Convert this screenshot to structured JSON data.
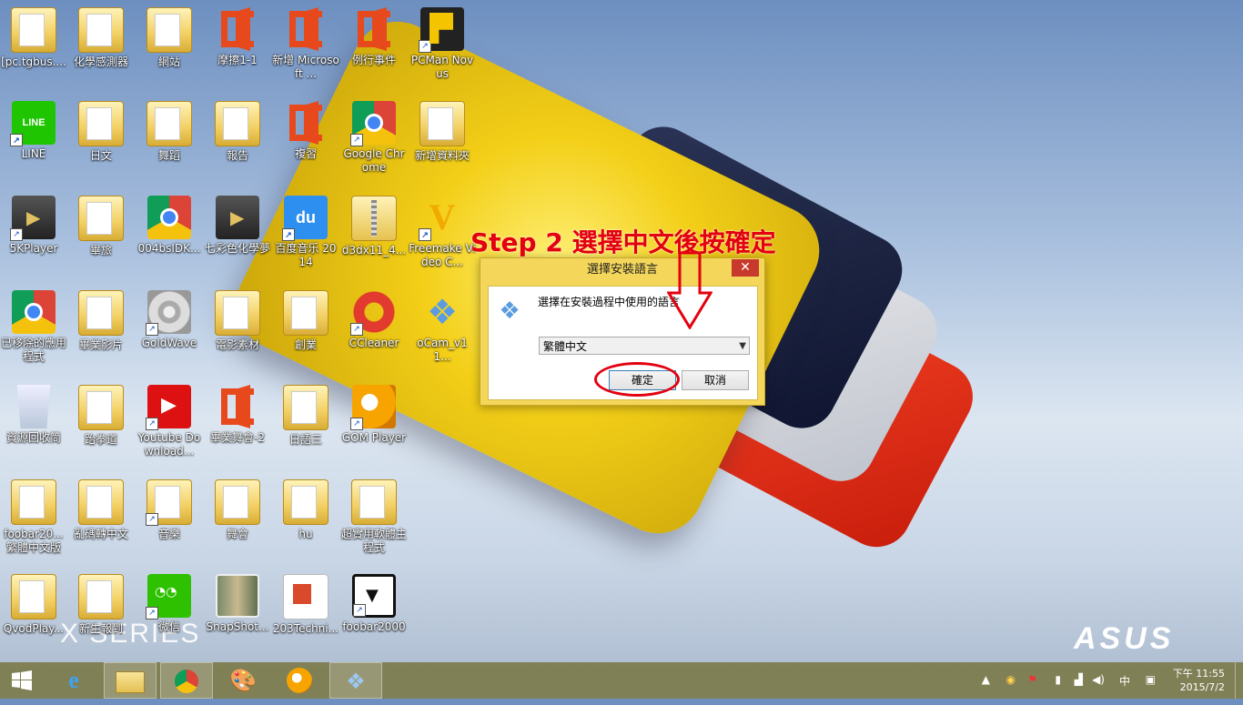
{
  "desktop": {
    "icons": [
      {
        "label": "[pc.tgbus....",
        "icon": "app-icon"
      },
      {
        "label": "化學感測器",
        "icon": "folder-icon"
      },
      {
        "label": "網站",
        "icon": "folder-icon"
      },
      {
        "label": "摩擦1-1",
        "icon": "office-icon"
      },
      {
        "label": "新增 Microsoft ...",
        "icon": "office-icon"
      },
      {
        "label": "例行事件",
        "icon": "office-icon"
      },
      {
        "label": "PCMan Novus",
        "icon": "pcman-icon"
      },
      {
        "label": "LINE",
        "icon": "line-icon"
      },
      {
        "label": "日文",
        "icon": "folder-icon"
      },
      {
        "label": "舞蹈",
        "icon": "folder-icon"
      },
      {
        "label": "報告",
        "icon": "folder-icon"
      },
      {
        "label": "複習",
        "icon": "office-icon"
      },
      {
        "label": "Google Chrome",
        "icon": "chrome-icon"
      },
      {
        "label": "新增資料夾",
        "icon": "folder-icon"
      },
      {
        "label": "5KPlayer",
        "icon": "5kplayer-icon"
      },
      {
        "label": "畢旅",
        "icon": "folder-icon"
      },
      {
        "label": "004bsIDK...",
        "icon": "chrome-icon"
      },
      {
        "label": "七彩色化學夢",
        "icon": "film-icon"
      },
      {
        "label": "百度音乐 2014",
        "icon": "baidu-icon"
      },
      {
        "label": "d3dx11_4...",
        "icon": "zip-icon"
      },
      {
        "label": "Freemake Video C...",
        "icon": "freemake-icon"
      },
      {
        "label": "已移除的應用程式",
        "icon": "chrome-icon"
      },
      {
        "label": "畢業影片",
        "icon": "folder-icon"
      },
      {
        "label": "GoldWave",
        "icon": "goldwave-icon"
      },
      {
        "label": "電影素材",
        "icon": "folder-icon"
      },
      {
        "label": "創業",
        "icon": "folder-icon"
      },
      {
        "label": "CCleaner",
        "icon": "ccleaner-icon"
      },
      {
        "label": "oCam_v11...",
        "icon": "ocam-icon"
      },
      {
        "label": "資源回收筒",
        "icon": "recycle-bin-icon"
      },
      {
        "label": "跆拳道",
        "icon": "folder-icon"
      },
      {
        "label": "Youtube Download...",
        "icon": "youtube-icon"
      },
      {
        "label": "畢業舞會-2",
        "icon": "office-icon"
      },
      {
        "label": "日語三",
        "icon": "folder-icon"
      },
      {
        "label": "GOM Player",
        "icon": "gom-icon"
      },
      {
        "label": "foobar20... 繁體中文版",
        "icon": "folder-icon"
      },
      {
        "label": "亂碼轉中文",
        "icon": "folder-icon"
      },
      {
        "label": "音樂",
        "icon": "folder-icon"
      },
      {
        "label": "舞會",
        "icon": "folder-icon"
      },
      {
        "label": "hu",
        "icon": "folder-icon"
      },
      {
        "label": "超實用軟體主程式",
        "icon": "folder-icon"
      },
      {
        "label": "QvodPlay...",
        "icon": "folder-icon"
      },
      {
        "label": "新生報到",
        "icon": "folder-icon"
      },
      {
        "label": "微信",
        "icon": "wechat-icon"
      },
      {
        "label": "SnapShot...",
        "icon": "snapshot-icon"
      },
      {
        "label": "203Techni...",
        "icon": "pdf-icon"
      },
      {
        "label": "foobar2000",
        "icon": "foobar-icon"
      }
    ]
  },
  "wallpaper": {
    "brand": "ASUS",
    "series": "X SERIES"
  },
  "annotation": {
    "text": "Step 2 選擇中文後按確定",
    "color": "#e3000f"
  },
  "dialog": {
    "title": "選擇安裝語言",
    "close_label": "✕",
    "message": "選擇在安裝過程中使用的語言",
    "language_select": "繁體中文",
    "ok_label": "確定",
    "cancel_label": "取消"
  },
  "taskbar": {
    "start_icon": "windows-logo-icon",
    "pinned": [
      "internet-explorer-icon",
      "file-explorer-icon",
      "chrome-icon",
      "paint-icon",
      "gom-icon",
      "installer-icon"
    ],
    "tray_icons": [
      "show-hidden-icon",
      "network-alert-icon",
      "flag-icon",
      "battery-icon",
      "signal-icon",
      "volume-icon"
    ],
    "ime": "中",
    "clock_time": "下午 11:55",
    "clock_date": "2015/7/2",
    "accent": "#7a7746"
  }
}
